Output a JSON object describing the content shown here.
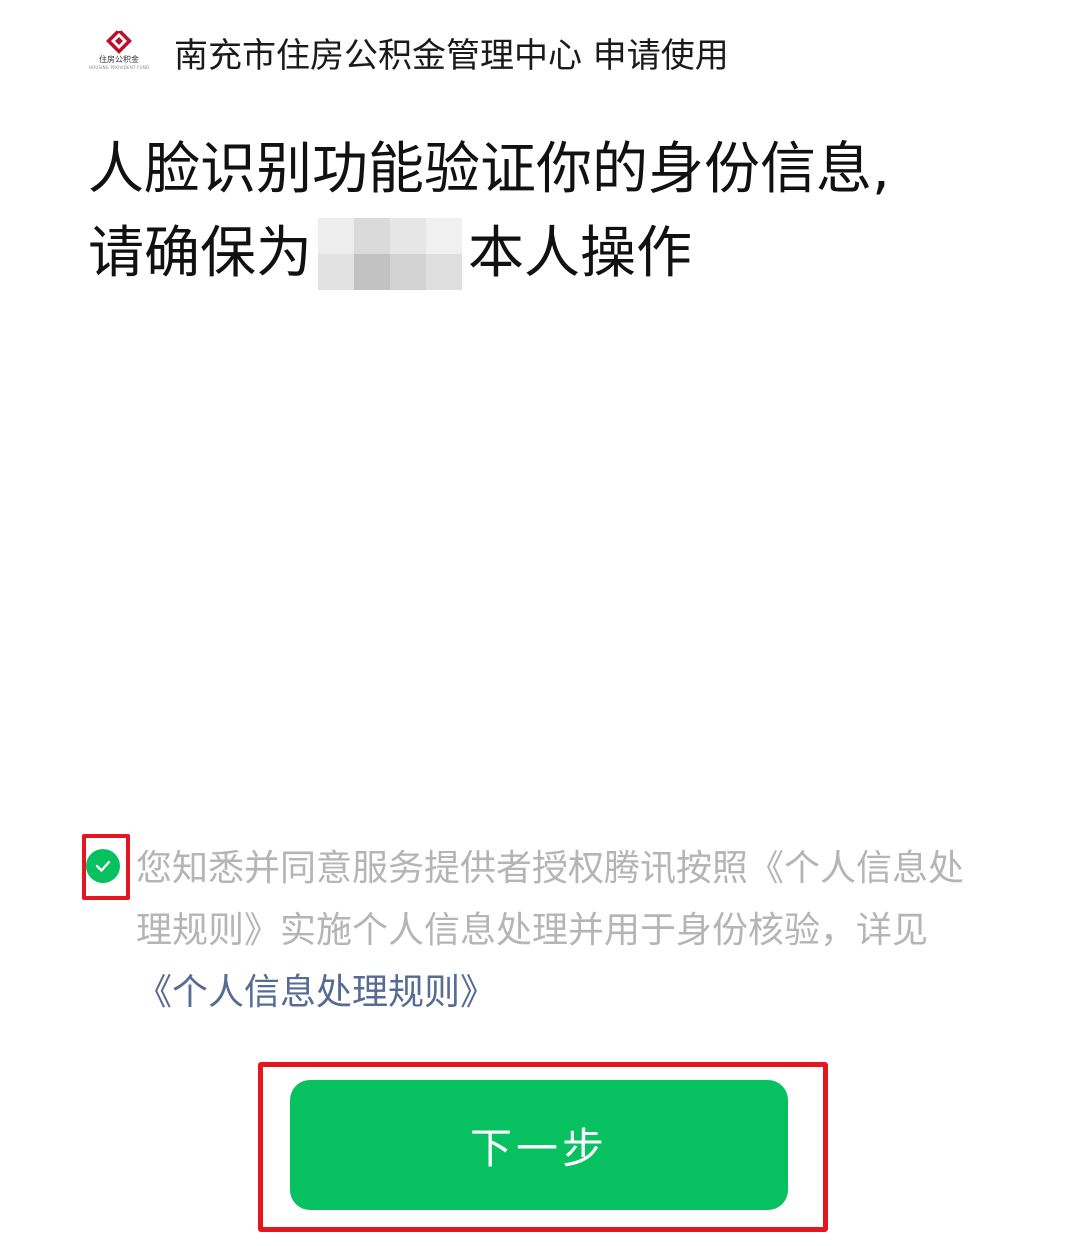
{
  "header": {
    "logo_text": "住房公积金",
    "logo_subtext": "HOUSING PROVIDENT FUND",
    "title": "南充市住房公积金管理中心 申请使用"
  },
  "headline": {
    "line1": "人脸识别功能验证你的身份信息,",
    "line2_prefix": "请确保为",
    "line2_suffix": "本人操作"
  },
  "consent": {
    "checked": true,
    "text": "您知悉并同意服务提供者授权腾讯按照《个人信息处理规则》实施个人信息处理并用于身份核验，详见",
    "link_text": "《个人信息处理规则》"
  },
  "next_button": {
    "label": "下一步"
  },
  "colors": {
    "accent_green": "#07c160",
    "link_blue": "#576b95",
    "annotation_red": "#e4161f",
    "muted_text": "#b5b5b5",
    "logo_red": "#b8112a"
  }
}
